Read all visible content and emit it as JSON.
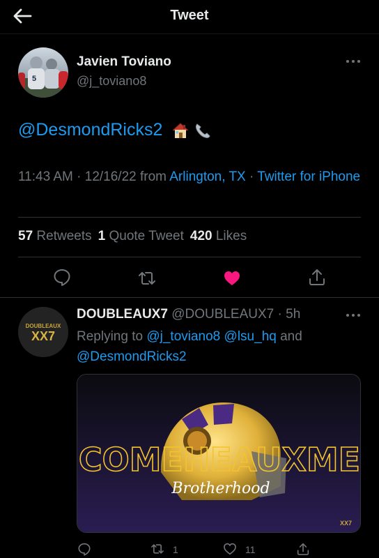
{
  "header": {
    "title": "Tweet"
  },
  "tweet": {
    "author_name": "Javien Toviano",
    "author_handle": "@j_toviano8",
    "mention": "@DesmondRicks2",
    "time": "11:43 AM",
    "dot1": " · ",
    "date": "12/16/22",
    "from_label": " from ",
    "location": "Arlington, TX",
    "dot2": " · ",
    "source": "Twitter for iPhone",
    "retweets_count": "57",
    "retweets_label": "Retweets",
    "quotes_count": "1",
    "quotes_label": "Quote Tweet",
    "likes_count": "420",
    "likes_label": "Likes",
    "liked": true
  },
  "reply": {
    "author_name": "DOUBLEAUX7",
    "author_handle": "@DOUBLEAUX7",
    "dot": " · ",
    "time": "5h",
    "replying_prefix": "Replying to ",
    "mention1": "@j_toviano8",
    "mention2": "@lsu_hq",
    "and_label": " and ",
    "mention3": "@DesmondRicks2",
    "avatar_text_top": "DOUBLEAUX",
    "avatar_text_main": "XX7",
    "media_headline": "COMEHEAUXME",
    "media_script": "Brotherhood",
    "media_badge": "XX7",
    "retweet_count": "1",
    "like_count": "11"
  },
  "colors": {
    "accent": "#1d9bf0",
    "like": "#f91880",
    "muted": "#71767b",
    "background": "#000000",
    "gold": "#f2c230"
  },
  "icons": [
    "back-arrow-icon",
    "more-icon",
    "reply-icon",
    "retweet-icon",
    "heart-icon",
    "share-icon",
    "house-emoji-icon",
    "phone-emoji-icon"
  ]
}
